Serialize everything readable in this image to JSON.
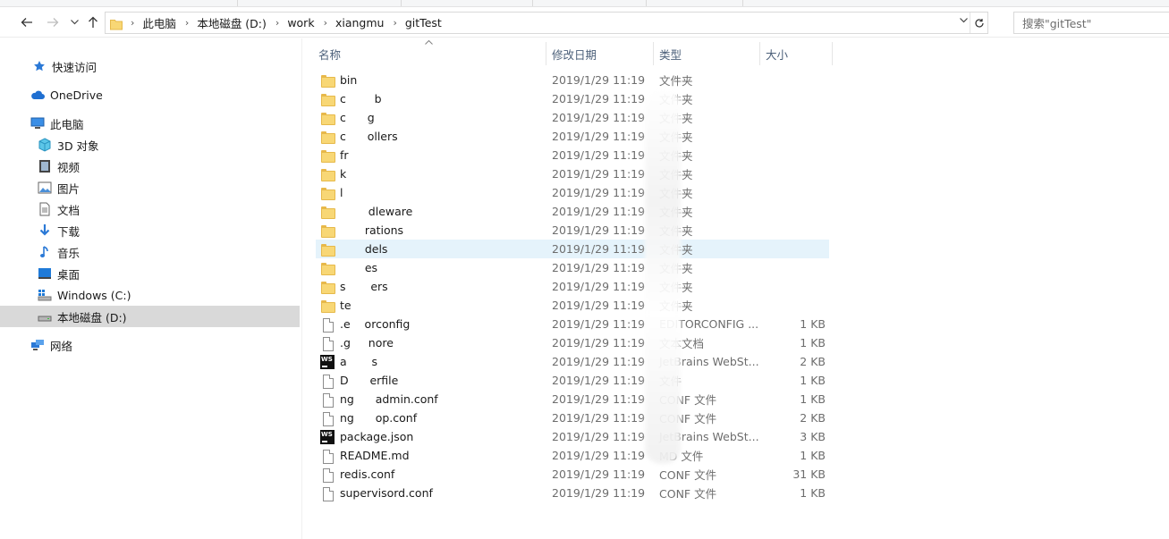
{
  "nav": {
    "back_icon": "arrow-left-icon",
    "forward_icon": "arrow-right-icon",
    "recent_icon": "chevron-down-icon",
    "up_icon": "arrow-up-icon"
  },
  "address": {
    "crumbs": [
      "此电脑",
      "本地磁盘 (D:)",
      "work",
      "xiangmu",
      "gitTest"
    ]
  },
  "search": {
    "placeholder": "搜索\"gitTest\""
  },
  "sidebar": {
    "items": [
      {
        "label": "快速访问",
        "icon": "star-icon"
      },
      {
        "label": "OneDrive",
        "icon": "cloud-icon"
      },
      {
        "label": "此电脑",
        "icon": "computer-icon"
      },
      {
        "label": "3D 对象",
        "icon": "cube-icon"
      },
      {
        "label": "视频",
        "icon": "video-icon"
      },
      {
        "label": "图片",
        "icon": "picture-icon"
      },
      {
        "label": "文档",
        "icon": "document-icon"
      },
      {
        "label": "下载",
        "icon": "download-icon"
      },
      {
        "label": "音乐",
        "icon": "music-icon"
      },
      {
        "label": "桌面",
        "icon": "desktop-icon"
      },
      {
        "label": "Windows (C:)",
        "icon": "drive-c-icon"
      },
      {
        "label": "本地磁盘 (D:)",
        "icon": "drive-d-icon"
      },
      {
        "label": "网络",
        "icon": "network-icon"
      }
    ]
  },
  "columns": {
    "name": "名称",
    "date": "修改日期",
    "type": "类型",
    "size": "大小"
  },
  "files": [
    {
      "name": "bin",
      "date": "2019/1/29 11:19",
      "type": "文件夹",
      "size": "",
      "icon": "folder-icon"
    },
    {
      "name": "c        b",
      "date": "2019/1/29 11:19",
      "type": "文件夹",
      "size": "",
      "icon": "folder-icon"
    },
    {
      "name": "c      g",
      "date": "2019/1/29 11:19",
      "type": "文件夹",
      "size": "",
      "icon": "folder-icon"
    },
    {
      "name": "c      ollers",
      "date": "2019/1/29 11:19",
      "type": "文件夹",
      "size": "",
      "icon": "folder-icon"
    },
    {
      "name": "fr",
      "date": "2019/1/29 11:19",
      "type": "文件夹",
      "size": "",
      "icon": "folder-icon"
    },
    {
      "name": "k",
      "date": "2019/1/29 11:19",
      "type": "文件夹",
      "size": "",
      "icon": "folder-icon"
    },
    {
      "name": "l",
      "date": "2019/1/29 11:19",
      "type": "文件夹",
      "size": "",
      "icon": "folder-icon"
    },
    {
      "name": "        dleware",
      "date": "2019/1/29 11:19",
      "type": "文件夹",
      "size": "",
      "icon": "folder-icon"
    },
    {
      "name": "       rations",
      "date": "2019/1/29 11:19",
      "type": "文件夹",
      "size": "",
      "icon": "folder-icon"
    },
    {
      "name": "       dels",
      "date": "2019/1/29 11:19",
      "type": "文件夹",
      "size": "",
      "icon": "folder-icon"
    },
    {
      "name": "       es",
      "date": "2019/1/29 11:19",
      "type": "文件夹",
      "size": "",
      "icon": "folder-icon"
    },
    {
      "name": "s       ers",
      "date": "2019/1/29 11:19",
      "type": "文件夹",
      "size": "",
      "icon": "folder-icon"
    },
    {
      "name": "te",
      "date": "2019/1/29 11:19",
      "type": "文件夹",
      "size": "",
      "icon": "folder-icon"
    },
    {
      "name": ".e    orconfig",
      "date": "2019/1/29 11:19",
      "type": "EDITORCONFIG ...",
      "size": "1 KB",
      "icon": "file-icon"
    },
    {
      "name": ".g     nore",
      "date": "2019/1/29 11:19",
      "type": "文本文档",
      "size": "1 KB",
      "icon": "file-icon"
    },
    {
      "name": "a       s",
      "date": "2019/1/29 11:19",
      "type": "JetBrains WebSt...",
      "size": "2 KB",
      "icon": "webstorm-icon"
    },
    {
      "name": "D      erfile",
      "date": "2019/1/29 11:19",
      "type": "文件",
      "size": "1 KB",
      "icon": "file-icon"
    },
    {
      "name": "ng      admin.conf",
      "date": "2019/1/29 11:19",
      "type": "CONF 文件",
      "size": "1 KB",
      "icon": "file-icon"
    },
    {
      "name": "ng      op.conf",
      "date": "2019/1/29 11:19",
      "type": "CONF 文件",
      "size": "2 KB",
      "icon": "file-icon"
    },
    {
      "name": "package.json",
      "date": "2019/1/29 11:19",
      "type": "JetBrains WebSt...",
      "size": "3 KB",
      "icon": "webstorm-icon"
    },
    {
      "name": "README.md",
      "date": "2019/1/29 11:19",
      "type": "MD 文件",
      "size": "1 KB",
      "icon": "file-icon"
    },
    {
      "name": "redis.conf",
      "date": "2019/1/29 11:19",
      "type": "CONF 文件",
      "size": "31 KB",
      "icon": "file-icon"
    },
    {
      "name": "supervisord.conf",
      "date": "2019/1/29 11:19",
      "type": "CONF 文件",
      "size": "1 KB",
      "icon": "file-icon"
    }
  ],
  "colors": {
    "selected_sidebar": "#d9d9d9",
    "hover_row": "#e5f3fb",
    "header_text": "#4c607a"
  }
}
